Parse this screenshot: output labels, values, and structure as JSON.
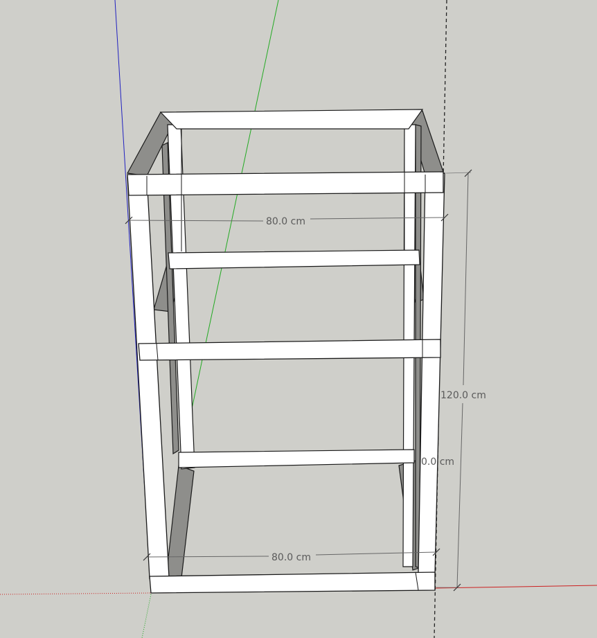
{
  "scene": {
    "background": "#cfcfca",
    "axis_colors": {
      "blue_axis": "#2020c0",
      "green_axis": "#22aa22",
      "red_axis": "#cc2020"
    },
    "frame_colors": {
      "front_face": "#ffffff",
      "shaded_face": "#8e8e8b",
      "edge": "#1a1a1a"
    }
  },
  "dimensions": {
    "top_width": "80.0 cm",
    "bottom_width": "80.0 cm",
    "height": "120.0 cm",
    "partial_depth": "0.0 cm"
  }
}
